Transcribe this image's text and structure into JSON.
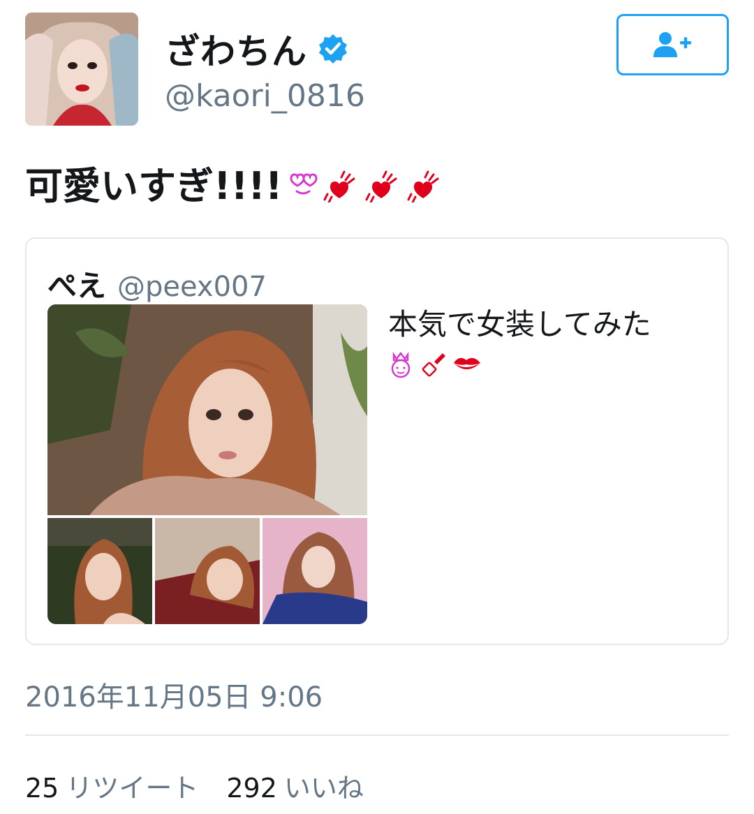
{
  "author": {
    "display_name": "ざわちん",
    "handle": "@kaori_0816",
    "verified": true
  },
  "follow_button": {
    "icon": "follow-user-icon"
  },
  "tweet": {
    "text": "可愛いすぎ!!!!",
    "emoji": [
      "heart-eyes-face",
      "two-hearts",
      "two-hearts",
      "two-hearts"
    ]
  },
  "quoted_tweet": {
    "display_name": "ぺえ",
    "handle": "@peex007",
    "text": "本気で女装してみた",
    "emoji": [
      "princess",
      "lipstick",
      "kiss-mark"
    ],
    "media_count": 4
  },
  "timestamp": "2016年11月05日 9:06",
  "stats": {
    "retweets_count": "25",
    "retweets_label": "リツイート",
    "likes_count": "292",
    "likes_label": "いいね"
  },
  "colors": {
    "accent": "#1da1f2",
    "secondary_text": "#657786",
    "border": "#e1e8ed",
    "heart": "#e0001b",
    "magenta": "#d63ad1"
  }
}
